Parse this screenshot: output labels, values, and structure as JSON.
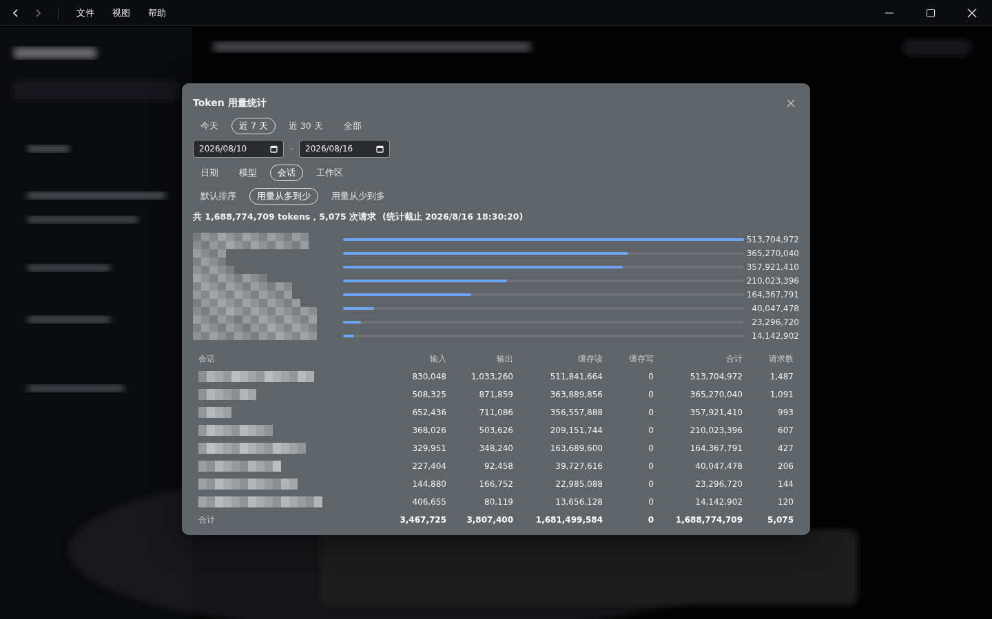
{
  "titlebar": {
    "menu": [
      "文件",
      "视图",
      "帮助"
    ]
  },
  "dialog": {
    "title": "Token 用量统计",
    "ranges": [
      {
        "label": "今天",
        "selected": false
      },
      {
        "label": "近 7 天",
        "selected": true
      },
      {
        "label": "近 30 天",
        "selected": false
      },
      {
        "label": "全部",
        "selected": false
      }
    ],
    "date_from": "2026/08/10",
    "date_sep": "–",
    "date_to": "2026/08/16",
    "groupings": [
      {
        "label": "日期",
        "selected": false
      },
      {
        "label": "模型",
        "selected": false
      },
      {
        "label": "会话",
        "selected": true
      },
      {
        "label": "工作区",
        "selected": false
      }
    ],
    "sorts": [
      {
        "label": "默认排序",
        "selected": false
      },
      {
        "label": "用量从多到少",
        "selected": true
      },
      {
        "label": "用量从少到多",
        "selected": false
      }
    ],
    "summary": "共 1,688,774,709 tokens，5,075 次请求  (统计截止 2026/8/16 18:30:20)",
    "bars": [
      {
        "level": 1,
        "value": "513,704,972"
      },
      {
        "level": 0.711,
        "value": "365,270,040"
      },
      {
        "level": 0.697,
        "value": "357,921,410"
      },
      {
        "level": 0.409,
        "value": "210,023,396"
      },
      {
        "level": 0.32,
        "value": "164,367,791"
      },
      {
        "level": 0.078,
        "value": "40,047,478"
      },
      {
        "level": 0.045,
        "value": "23,296,720"
      },
      {
        "level": 0.028,
        "value": "14,142,902"
      }
    ],
    "table": {
      "columns": [
        "会话",
        "输入",
        "输出",
        "缓存读",
        "缓存写",
        "合计",
        "请求数"
      ],
      "rows": [
        [
          "",
          "830,048",
          "1,033,260",
          "511,841,664",
          "0",
          "513,704,972",
          "1,487"
        ],
        [
          "",
          "508,325",
          "871,859",
          "363,889,856",
          "0",
          "365,270,040",
          "1,091"
        ],
        [
          "",
          "652,436",
          "711,086",
          "356,557,888",
          "0",
          "357,921,410",
          "993"
        ],
        [
          "",
          "368,026",
          "503,626",
          "209,151,744",
          "0",
          "210,023,396",
          "607"
        ],
        [
          "",
          "329,951",
          "348,240",
          "163,689,600",
          "0",
          "164,367,791",
          "427"
        ],
        [
          "",
          "227,404",
          "92,458",
          "39,727,616",
          "0",
          "40,047,478",
          "206"
        ],
        [
          "",
          "144,880",
          "166,752",
          "22,985,088",
          "0",
          "23,296,720",
          "144"
        ],
        [
          "",
          "406,655",
          "80,119",
          "13,656,128",
          "0",
          "14,142,902",
          "120"
        ]
      ],
      "totals": [
        "合计",
        "3,467,725",
        "3,807,400",
        "1,681,499,584",
        "0",
        "1,688,774,709",
        "5,075"
      ]
    }
  }
}
